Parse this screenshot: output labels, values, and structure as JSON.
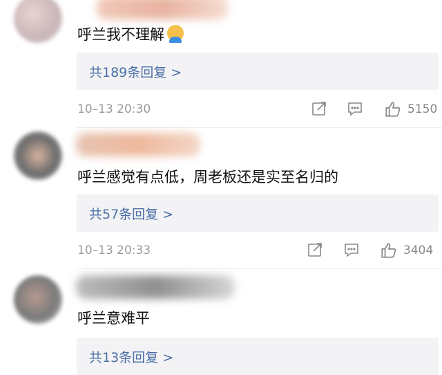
{
  "comments": [
    {
      "text": "呼兰我不理解",
      "has_emoji": true,
      "replies": "共189条回复 >",
      "time": "10–13 20:30",
      "likes": "5150"
    },
    {
      "text": "呼兰感觉有点低，周老板还是实至名归的",
      "has_emoji": false,
      "replies": "共57条回复 >",
      "time": "10–13 20:33",
      "likes": "3404"
    },
    {
      "text": "呼兰意难平",
      "has_emoji": false,
      "replies": "共13条回复 >",
      "time": "",
      "likes": ""
    }
  ],
  "icons": [
    "share-icon",
    "comment-icon",
    "like-icon"
  ],
  "colors": {
    "link": "#4a6fa6",
    "reply_bg": "#f3f3f5",
    "meta": "#9a9a9a"
  }
}
